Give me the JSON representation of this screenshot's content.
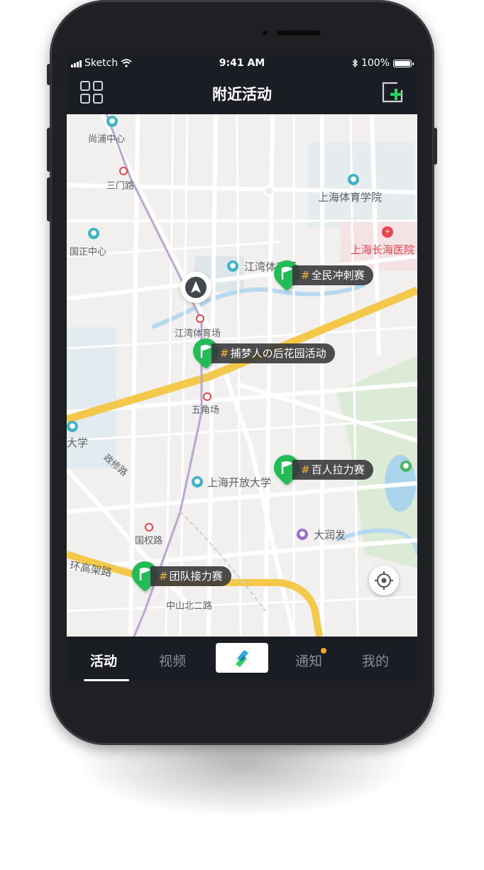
{
  "status_bar": {
    "carrier": "Sketch",
    "time": "9:41 AM",
    "battery": "100%"
  },
  "nav": {
    "title": "附近活动",
    "left_icon": "grid-icon",
    "right_icon": "add-square-icon"
  },
  "map": {
    "labels": {
      "shangshan": "尚浦中心",
      "sanmenlu": "三门路",
      "guozheng": "国正中心",
      "tiyuxueyuan": "上海体育学院",
      "changhai": "上海长海医院",
      "jiangwan_stadium": "江湾体育场",
      "jiangwan_station": "江湾体育场",
      "wujiaochang": "五角场",
      "daxue": "大学",
      "zhengxiu": "政修路",
      "kaifang": "上海开放大学",
      "runfa": "大润发",
      "guoquan": "国权路",
      "huangao": "环高架路",
      "zhongshan": "中山北二路"
    },
    "markers": [
      {
        "label": "全民冲刺赛",
        "hash": "#"
      },
      {
        "label": "捕梦人の后花园活动",
        "hash": "#"
      },
      {
        "label": "百人拉力赛",
        "hash": "#"
      },
      {
        "label": "团队接力赛",
        "hash": "#"
      }
    ]
  },
  "tabs": [
    {
      "label": "活动",
      "active": true
    },
    {
      "label": "视频",
      "active": false
    },
    {
      "label": "",
      "icon": "app-logo-icon"
    },
    {
      "label": "通知",
      "active": false,
      "badge": true
    },
    {
      "label": "我的",
      "active": false
    }
  ],
  "colors": {
    "accent_green": "#22bb55",
    "tag_bg": "#343438",
    "hash_orange": "#f6b730",
    "bg_dark": "#1b1d24",
    "road_yellow": "#f4c84b"
  }
}
